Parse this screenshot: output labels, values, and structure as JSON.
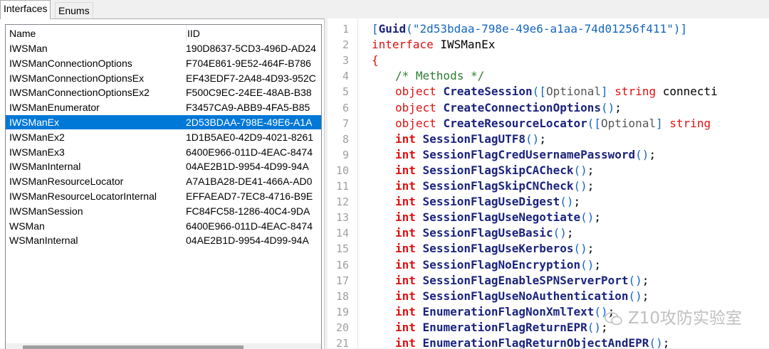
{
  "tabs": [
    {
      "label": "Interfaces",
      "active": true
    },
    {
      "label": "Enums",
      "active": false
    }
  ],
  "list": {
    "columns": [
      "Name",
      "IID"
    ],
    "rows": [
      {
        "name": "IWSMan",
        "iid": "190D8637-5CD3-496D-AD24",
        "selected": false
      },
      {
        "name": "IWSManConnectionOptions",
        "iid": "F704E861-9E52-464F-B786",
        "selected": false
      },
      {
        "name": "IWSManConnectionOptionsEx",
        "iid": "EF43EDF7-2A48-4D93-952C",
        "selected": false
      },
      {
        "name": "IWSManConnectionOptionsEx2",
        "iid": "F500C9EC-24EE-48AB-B38",
        "selected": false
      },
      {
        "name": "IWSManEnumerator",
        "iid": "F3457CA9-ABB9-4FA5-B85",
        "selected": false
      },
      {
        "name": "IWSManEx",
        "iid": "2D53BDAA-798E-49E6-A1A",
        "selected": true
      },
      {
        "name": "IWSManEx2",
        "iid": "1D1B5AE0-42D9-4021-8261",
        "selected": false
      },
      {
        "name": "IWSManEx3",
        "iid": "6400E966-011D-4EAC-8474",
        "selected": false
      },
      {
        "name": "IWSManInternal",
        "iid": "04AE2B1D-9954-4D99-94A",
        "selected": false
      },
      {
        "name": "IWSManResourceLocator",
        "iid": "A7A1BA28-DE41-466A-AD0",
        "selected": false
      },
      {
        "name": "IWSManResourceLocatorInternal",
        "iid": "EFFAEAD7-7EC8-4716-B9E",
        "selected": false
      },
      {
        "name": "IWSManSession",
        "iid": "FC84FC58-1286-40C4-9DA",
        "selected": false
      },
      {
        "name": "WSMan",
        "iid": "6400E966-011D-4EAC-8474",
        "selected": false
      },
      {
        "name": "WSManInternal",
        "iid": "04AE2B1D-9954-4D99-94A",
        "selected": false
      }
    ]
  },
  "code": {
    "guid_attr": "Guid",
    "guid_value": "\"2d53bdaa-798e-49e6-a1aa-74d01256f411\"",
    "interface_kw": "interface",
    "interface_name": "IWSManEx",
    "open_brace": "{",
    "comment": "/* Methods */",
    "methods": [
      {
        "ret": "object",
        "name": "CreateSession",
        "args": "[Optional] string connecti"
      },
      {
        "ret": "object",
        "name": "CreateConnectionOptions",
        "args": ""
      },
      {
        "ret": "object",
        "name": "CreateResourceLocator",
        "args": "[Optional] string"
      },
      {
        "ret": "int",
        "name": "SessionFlagUTF8",
        "args": ""
      },
      {
        "ret": "int",
        "name": "SessionFlagCredUsernamePassword",
        "args": ""
      },
      {
        "ret": "int",
        "name": "SessionFlagSkipCACheck",
        "args": ""
      },
      {
        "ret": "int",
        "name": "SessionFlagSkipCNCheck",
        "args": ""
      },
      {
        "ret": "int",
        "name": "SessionFlagUseDigest",
        "args": ""
      },
      {
        "ret": "int",
        "name": "SessionFlagUseNegotiate",
        "args": ""
      },
      {
        "ret": "int",
        "name": "SessionFlagUseBasic",
        "args": ""
      },
      {
        "ret": "int",
        "name": "SessionFlagUseKerberos",
        "args": ""
      },
      {
        "ret": "int",
        "name": "SessionFlagNoEncryption",
        "args": ""
      },
      {
        "ret": "int",
        "name": "SessionFlagEnableSPNServerPort",
        "args": ""
      },
      {
        "ret": "int",
        "name": "SessionFlagUseNoAuthentication",
        "args": ""
      },
      {
        "ret": "int",
        "name": "EnumerationFlagNonXmlText",
        "args": ""
      },
      {
        "ret": "int",
        "name": "EnumerationFlagReturnEPR",
        "args": ""
      },
      {
        "ret": "int",
        "name": "EnumerationFlagReturnObjectAndEPR",
        "args": ""
      }
    ]
  },
  "watermark": "Z10攻防实验室",
  "colors": {
    "selection": "#0078d7",
    "keyword": "#e01010",
    "method": "#1a237e",
    "comment": "#2e7d32",
    "string": "#1565c0"
  }
}
